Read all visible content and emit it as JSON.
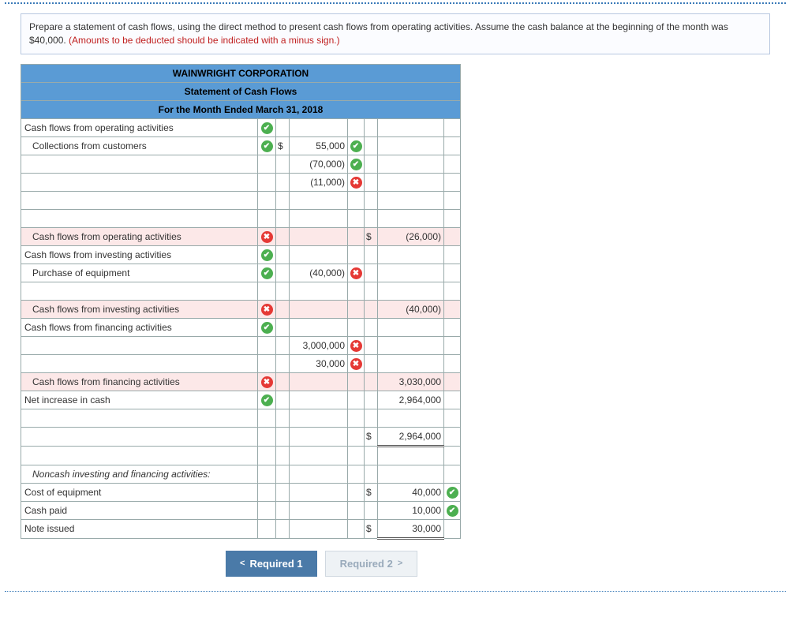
{
  "prompt": {
    "text": "Prepare a statement of cash flows, using the direct method to present cash flows from operating activities. Assume the cash balance at the beginning of the month was $40,000. ",
    "warn": "(Amounts to be deducted should be indicated with a minus sign.)"
  },
  "header": {
    "l1": "WAINWRIGHT CORPORATION",
    "l2": "Statement of Cash Flows",
    "l3": "For the Month Ended March 31, 2018"
  },
  "rows": {
    "r1": {
      "label": "Cash flows from operating activities",
      "icon": "ok"
    },
    "r2": {
      "label": "Collections from customers",
      "icon": "ok",
      "c1": "$",
      "v1": "55,000",
      "i1": "ok"
    },
    "r3": {
      "v1": "(70,000)",
      "i1": "ok"
    },
    "r4": {
      "v1": "(11,000)",
      "i1": "bad"
    },
    "r5": {},
    "r6": {},
    "r7": {
      "label": "Cash flows from operating activities",
      "icon": "bad",
      "c2": "$",
      "v2": "(26,000)"
    },
    "r8": {
      "label": "Cash flows from investing activities",
      "icon": "ok"
    },
    "r9": {
      "label": "Purchase of equipment",
      "icon": "ok",
      "v1": "(40,000)",
      "i1": "bad"
    },
    "r10": {},
    "r11": {
      "label": "Cash flows from investing activities",
      "icon": "bad",
      "v2": "(40,000)"
    },
    "r12": {
      "label": "Cash flows from financing activities",
      "icon": "ok"
    },
    "r13": {
      "v1": "3,000,000",
      "i1": "bad"
    },
    "r14": {
      "v1": "30,000",
      "i1": "bad"
    },
    "r15": {
      "label": "Cash flows from financing activities",
      "icon": "bad",
      "v2": "3,030,000"
    },
    "r16": {
      "label": "Net increase in cash",
      "icon": "ok",
      "v2": "2,964,000"
    },
    "r17": {},
    "r18": {
      "c2": "$",
      "v2": "2,964,000"
    },
    "r19": {},
    "r20": {
      "label": "Noncash investing and financing activities:"
    },
    "r21": {
      "label": "Cost of equipment",
      "c2": "$",
      "v2": "40,000",
      "i2": "ok"
    },
    "r22": {
      "label": "Cash paid",
      "v2": "10,000",
      "i2": "ok"
    },
    "r23": {
      "label": "Note issued",
      "c2": "$",
      "v2": "30,000"
    }
  },
  "buttons": {
    "prev": "Required 1",
    "next": "Required 2"
  },
  "glyph": {
    "ok": "✔",
    "bad": "✖",
    "left": "<",
    "right": ">"
  }
}
